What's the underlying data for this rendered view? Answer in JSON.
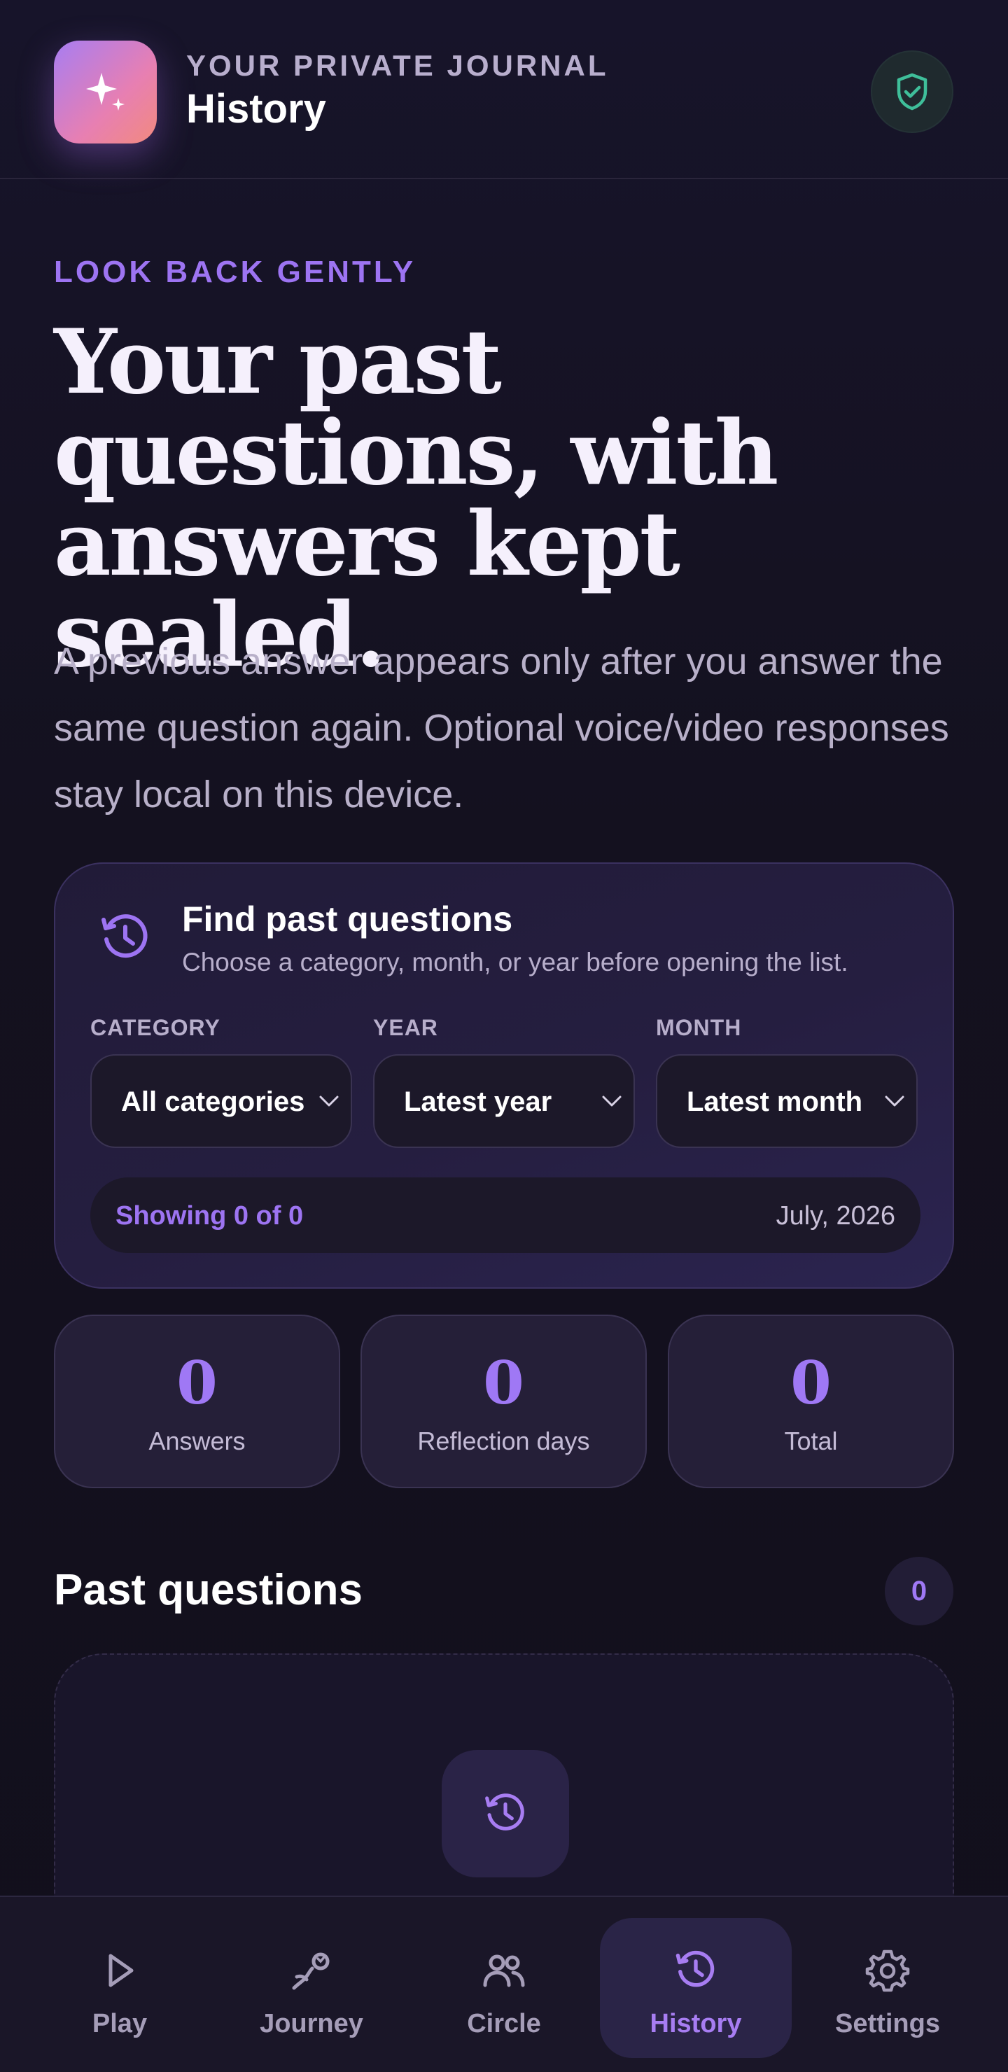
{
  "header": {
    "kicker": "YOUR PRIVATE JOURNAL",
    "title": "History",
    "logo_icon": "sparkle-icon",
    "privacy_icon": "shield-check-icon"
  },
  "hero": {
    "eyebrow": "LOOK BACK GENTLY",
    "title": "Your past questions, with answers kept sealed.",
    "description": "A previous answer appears only after you answer the same question again. Optional voice/video responses stay local on this device."
  },
  "filter": {
    "icon": "history-icon",
    "title": "Find past questions",
    "subtitle": "Choose a category, month, or year before opening the list.",
    "fields": [
      {
        "label": "CATEGORY",
        "value": "All categories"
      },
      {
        "label": "YEAR",
        "value": "Latest year"
      },
      {
        "label": "MONTH",
        "value": "Latest month"
      }
    ],
    "showing": "Showing 0 of 0",
    "date": "July, 2026"
  },
  "stats": [
    {
      "value": "0",
      "label": "Answers"
    },
    {
      "value": "0",
      "label": "Reflection days"
    },
    {
      "value": "0",
      "label": "Total"
    }
  ],
  "past": {
    "title": "Past questions",
    "count": "0",
    "empty_icon": "history-icon"
  },
  "nav": [
    {
      "label": "Play",
      "icon": "play-icon",
      "active": false
    },
    {
      "label": "Journey",
      "icon": "journey-icon",
      "active": false
    },
    {
      "label": "Circle",
      "icon": "people-icon",
      "active": false
    },
    {
      "label": "History",
      "icon": "history-icon",
      "active": true
    },
    {
      "label": "Settings",
      "icon": "gear-icon",
      "active": false
    }
  ],
  "colors": {
    "accent": "#9d74f2",
    "background": "#14111f",
    "card": "#251f38",
    "privacy_green": "#3fbf9a"
  }
}
